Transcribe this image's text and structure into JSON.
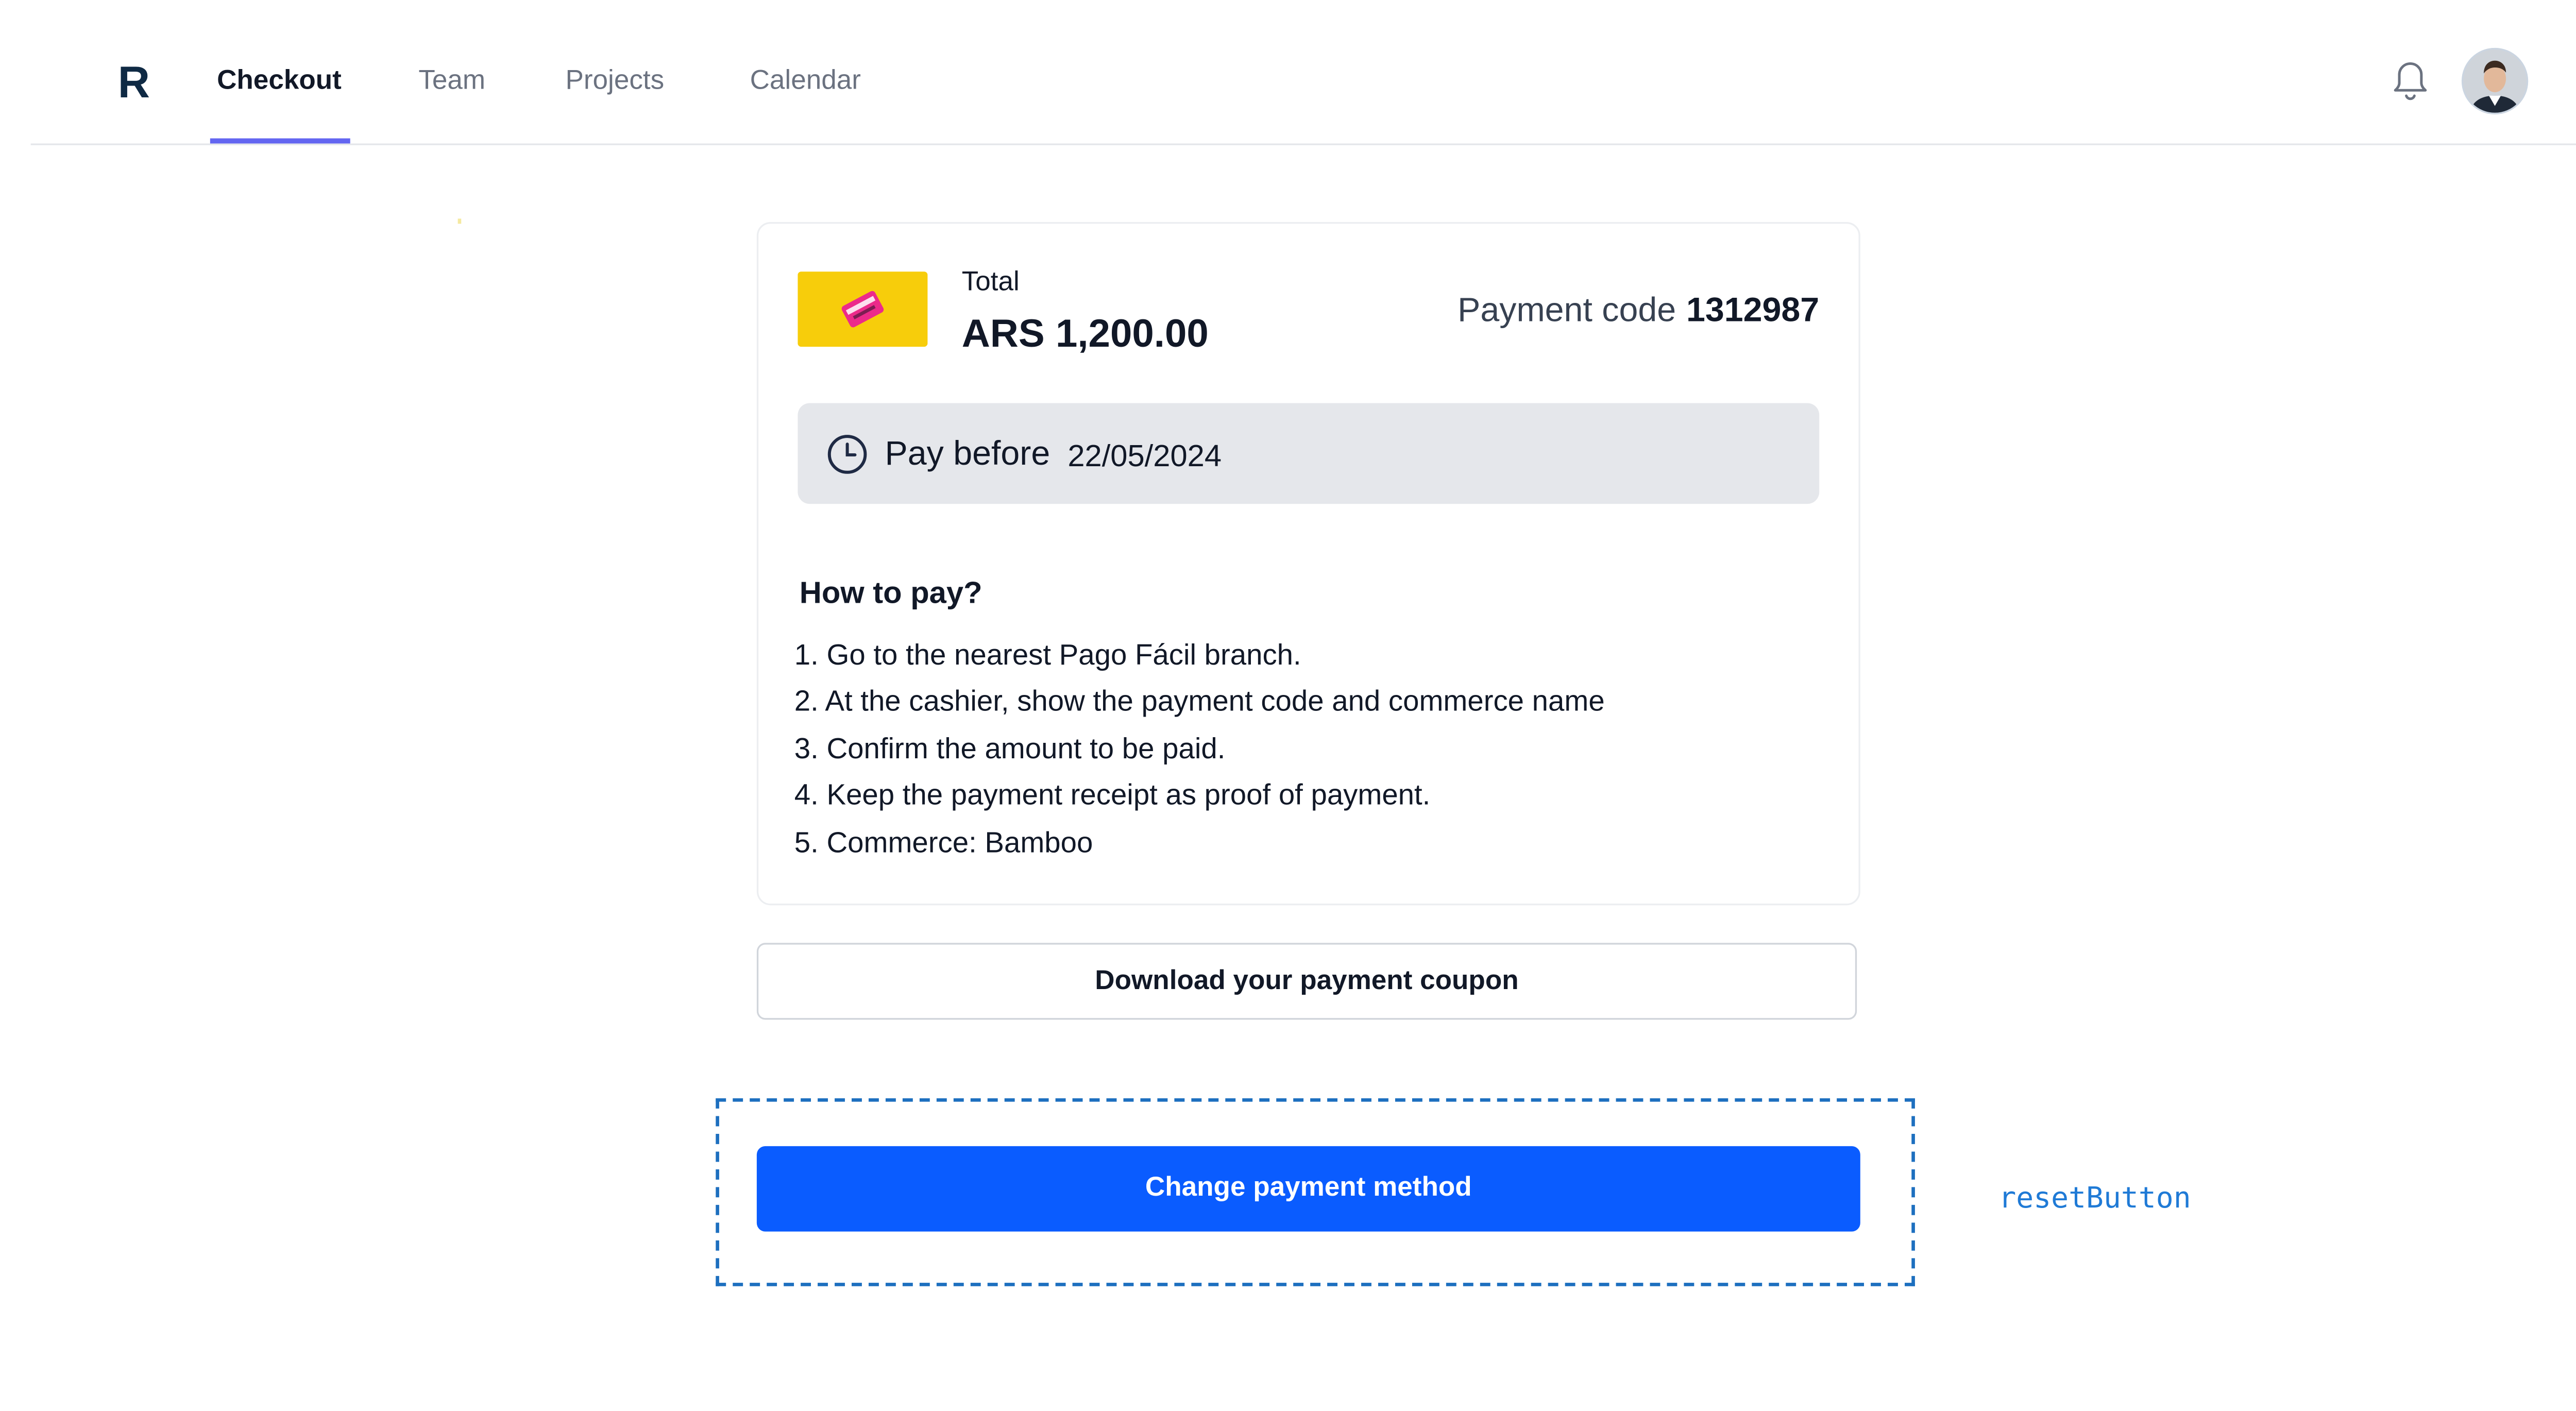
{
  "nav": {
    "brand": "R",
    "tabs": [
      {
        "label": "Checkout",
        "active": true
      },
      {
        "label": "Team",
        "active": false
      },
      {
        "label": "Projects",
        "active": false
      },
      {
        "label": "Calendar",
        "active": false
      }
    ],
    "notification_icon": "bell-icon",
    "avatar_icon": "user-avatar"
  },
  "card": {
    "logo_icon": "pago-facil-logo",
    "total_label": "Total",
    "total_value": "ARS 1,200.00",
    "payment_code_label": "Payment code",
    "payment_code_value": "1312987",
    "pay_before_icon": "clock-icon",
    "pay_before_label": "Pay before",
    "pay_before_date": "22/05/2024",
    "howto_title": "How to pay?",
    "steps": [
      "1. Go to the nearest Pago Fácil branch.",
      "2. At the cashier, show the payment code and commerce name",
      "3. Confirm the amount to be paid.",
      "4. Keep the payment receipt as proof of payment.",
      "5. Commerce: Bamboo"
    ]
  },
  "actions": {
    "download_label": "Download your payment coupon",
    "change_label": "Change payment method",
    "annotation_label": "resetButton"
  },
  "colors": {
    "accent_underline": "#6366f1",
    "primary_button": "#0a5cff",
    "logo_background": "#f7cd0b",
    "annotation": "#1f7ad6"
  }
}
